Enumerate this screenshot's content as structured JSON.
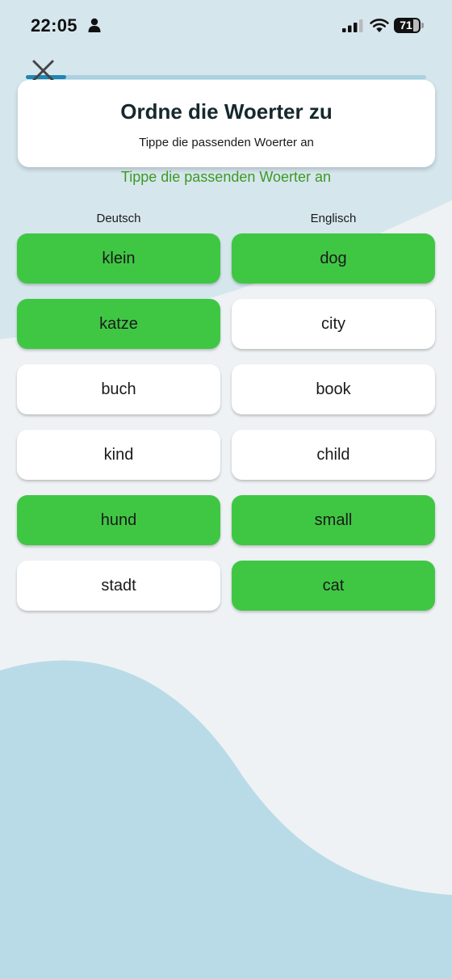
{
  "status_bar": {
    "time": "22:05",
    "battery": "71",
    "icons": [
      "person-icon",
      "signal-icon",
      "wifi-icon",
      "battery-icon"
    ]
  },
  "progress": {
    "fraction": 0.1
  },
  "close_icon": "close-icon",
  "header": {
    "title": "Ordne die Woerter zu",
    "subtitle": "Tippe die passenden Woerter an"
  },
  "hint": "Tippe die passenden Woerter an",
  "columns": {
    "left": "Deutsch",
    "right": "Englisch"
  },
  "words": {
    "left": [
      {
        "text": "klein",
        "matched": true
      },
      {
        "text": "katze",
        "matched": true
      },
      {
        "text": "buch",
        "matched": false
      },
      {
        "text": "kind",
        "matched": false
      },
      {
        "text": "hund",
        "matched": true
      },
      {
        "text": "stadt",
        "matched": false
      }
    ],
    "right": [
      {
        "text": "dog",
        "matched": true
      },
      {
        "text": "city",
        "matched": false
      },
      {
        "text": "book",
        "matched": false
      },
      {
        "text": "child",
        "matched": false
      },
      {
        "text": "small",
        "matched": true
      },
      {
        "text": "cat",
        "matched": true
      }
    ]
  },
  "colors": {
    "matched": "#3fc744",
    "unmatched": "#ffffff",
    "hint": "#3c9a24",
    "progress": "#1e87b5",
    "progress_track": "#a9d2e2"
  }
}
